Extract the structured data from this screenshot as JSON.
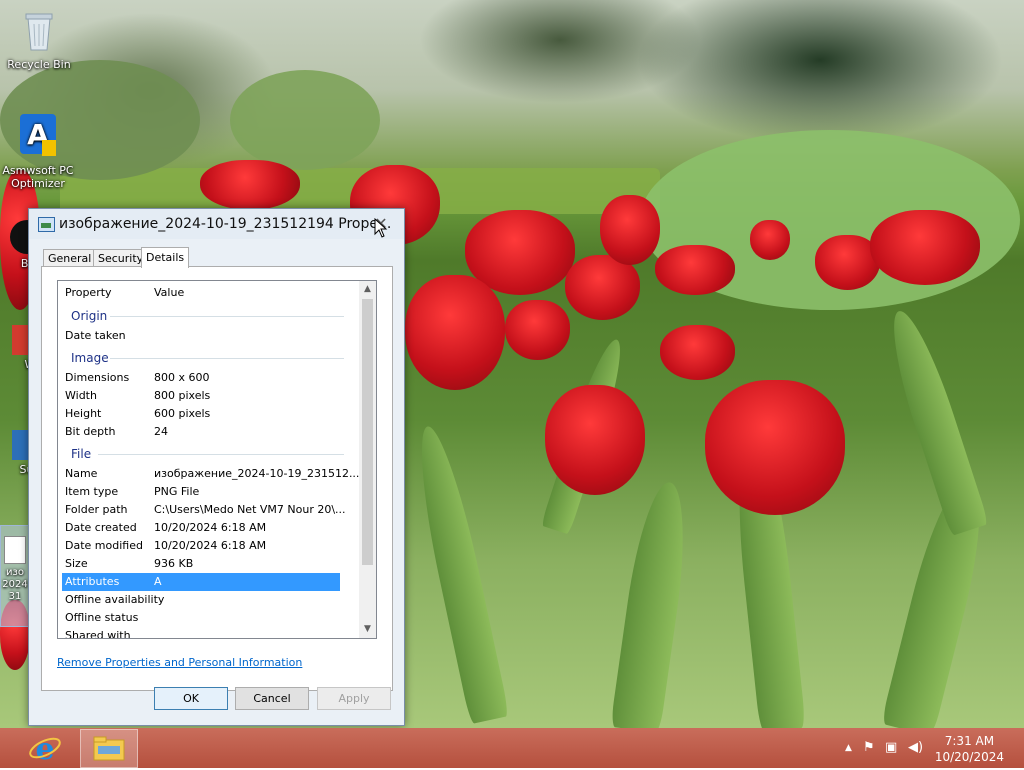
{
  "desktop": {
    "icons": [
      {
        "label": "Recycle Bin",
        "icon": "recycle-bin-icon"
      },
      {
        "label": "Asmwsoft PC Optimizer",
        "icon": "asmwsoft-icon"
      },
      {
        "label": "Ba",
        "icon": "app-icon"
      },
      {
        "label": "W",
        "icon": "app-icon"
      },
      {
        "label": "Sup",
        "icon": "app-icon"
      },
      {
        "label": "изо\n2024\n31",
        "icon": "image-file-icon"
      }
    ]
  },
  "dialog": {
    "title": "изображение_2024-10-19_231512194 Prope...",
    "tabs": [
      "General",
      "Security",
      "Details"
    ],
    "active_tab": "Details",
    "columns": {
      "property": "Property",
      "value": "Value"
    },
    "groups": {
      "origin": "Origin",
      "image": "Image",
      "file": "File"
    },
    "rows": {
      "date_taken": {
        "k": "Date taken",
        "v": ""
      },
      "dimensions": {
        "k": "Dimensions",
        "v": "800 x 600"
      },
      "width": {
        "k": "Width",
        "v": "800 pixels"
      },
      "height": {
        "k": "Height",
        "v": "600 pixels"
      },
      "bit_depth": {
        "k": "Bit depth",
        "v": "24"
      },
      "name": {
        "k": "Name",
        "v": "изображение_2024-10-19_231512..."
      },
      "item_type": {
        "k": "Item type",
        "v": "PNG File"
      },
      "folder_path": {
        "k": "Folder path",
        "v": "C:\\Users\\Medo Net VM7 Nour 20\\..."
      },
      "date_created": {
        "k": "Date created",
        "v": "10/20/2024 6:18 AM"
      },
      "date_modified": {
        "k": "Date modified",
        "v": "10/20/2024 6:18 AM"
      },
      "size": {
        "k": "Size",
        "v": "936 KB"
      },
      "attributes": {
        "k": "Attributes",
        "v": "A"
      },
      "offline_availability": {
        "k": "Offline availability",
        "v": ""
      },
      "offline_status": {
        "k": "Offline status",
        "v": ""
      },
      "shared_with": {
        "k": "Shared with",
        "v": ""
      }
    },
    "selected_row": "Attributes",
    "remove_link": "Remove Properties and Personal Information",
    "buttons": {
      "ok": "OK",
      "cancel": "Cancel",
      "apply": "Apply"
    }
  },
  "taskbar": {
    "pinned": [
      "internet-explorer-icon",
      "file-explorer-icon"
    ],
    "tray_icons": [
      "show-hidden-icons-icon",
      "action-center-flag-icon",
      "network-icon",
      "volume-icon"
    ],
    "time": "7:31 AM",
    "date": "10/20/2024"
  },
  "colors": {
    "taskbar": "#b5503e",
    "selection": "#3399ff",
    "link": "#0066cc"
  }
}
